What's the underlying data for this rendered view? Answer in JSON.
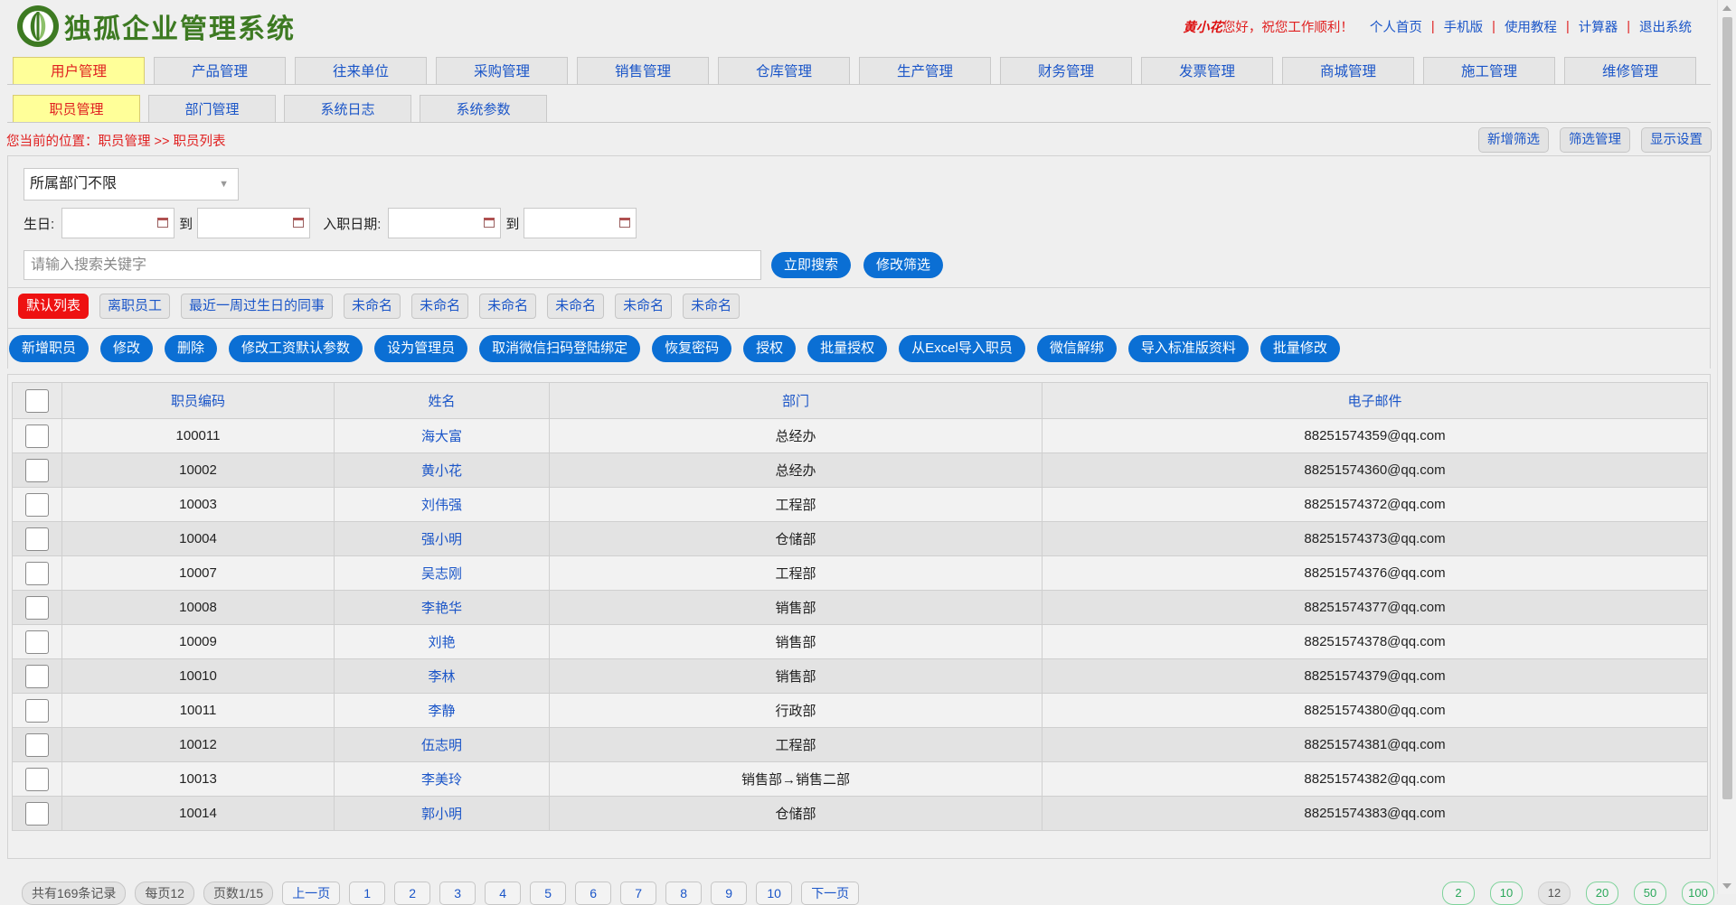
{
  "header": {
    "logo_text": "独孤企业管理系统",
    "user_name": "黄小花",
    "greeting": "您好，祝您工作顺利！",
    "links": [
      "个人首页",
      "手机版",
      "使用教程",
      "计算器",
      "退出系统"
    ]
  },
  "main_tabs": [
    "用户管理",
    "产品管理",
    "往来单位",
    "采购管理",
    "销售管理",
    "仓库管理",
    "生产管理",
    "财务管理",
    "发票管理",
    "商城管理",
    "施工管理",
    "维修管理"
  ],
  "main_tab_active": "用户管理",
  "sub_tabs": [
    "职员管理",
    "部门管理",
    "系统日志",
    "系统参数"
  ],
  "sub_tab_active": "职员管理",
  "breadcrumb": "您当前的位置：职员管理 >> 职员列表",
  "filter_buttons": [
    "新增筛选",
    "筛选管理",
    "显示设置"
  ],
  "filters": {
    "department_select": "所属部门不限",
    "birthday_label": "生日:",
    "to_label": "到",
    "hire_date_label": "入职日期:",
    "search_placeholder": "请输入搜索关键字",
    "search_button": "立即搜索",
    "edit_filter_button": "修改筛选"
  },
  "list_tags": [
    "默认列表",
    "离职员工",
    "最近一周过生日的同事",
    "未命名",
    "未命名",
    "未命名",
    "未命名",
    "未命名",
    "未命名"
  ],
  "actions": [
    "新增职员",
    "修改",
    "删除",
    "修改工资默认参数",
    "设为管理员",
    "取消微信扫码登陆绑定",
    "恢复密码",
    "授权",
    "批量授权",
    "从Excel导入职员",
    "微信解绑",
    "导入标准版资料",
    "批量修改"
  ],
  "table": {
    "columns": [
      "职员编码",
      "姓名",
      "部门",
      "电子邮件"
    ],
    "rows": [
      {
        "code": "100011",
        "name": "海大富",
        "dept": "总经办",
        "email": "88251574359@qq.com"
      },
      {
        "code": "10002",
        "name": "黄小花",
        "dept": "总经办",
        "email": "88251574360@qq.com"
      },
      {
        "code": "10003",
        "name": "刘伟强",
        "dept": "工程部",
        "email": "88251574372@qq.com"
      },
      {
        "code": "10004",
        "name": "强小明",
        "dept": "仓储部",
        "email": "88251574373@qq.com"
      },
      {
        "code": "10007",
        "name": "吴志刚",
        "dept": "工程部",
        "email": "88251574376@qq.com"
      },
      {
        "code": "10008",
        "name": "李艳华",
        "dept": "销售部",
        "email": "88251574377@qq.com"
      },
      {
        "code": "10009",
        "name": "刘艳",
        "dept": "销售部",
        "email": "88251574378@qq.com"
      },
      {
        "code": "10010",
        "name": "李林",
        "dept": "销售部",
        "email": "88251574379@qq.com"
      },
      {
        "code": "10011",
        "name": "李静",
        "dept": "行政部",
        "email": "88251574380@qq.com"
      },
      {
        "code": "10012",
        "name": "伍志明",
        "dept": "工程部",
        "email": "88251574381@qq.com"
      },
      {
        "code": "10013",
        "name": "李美玲",
        "dept": "销售部→销售二部",
        "email": "88251574382@qq.com"
      },
      {
        "code": "10014",
        "name": "郭小明",
        "dept": "仓储部",
        "email": "88251574383@qq.com"
      }
    ]
  },
  "pager": {
    "total": "共有169条记录",
    "per_page": "每页12",
    "page_info": "页数1/15",
    "prev": "上一页",
    "pages": [
      "1",
      "2",
      "3",
      "4",
      "5",
      "6",
      "7",
      "8",
      "9",
      "10"
    ],
    "next": "下一页",
    "sizes": [
      "2",
      "10",
      "12",
      "20",
      "50",
      "100"
    ],
    "size_active": "12"
  },
  "colors": {
    "accent": "#0b6fd4",
    "active_tab": "#ffff99",
    "danger": "#e11111",
    "link": "#1a55c8"
  }
}
